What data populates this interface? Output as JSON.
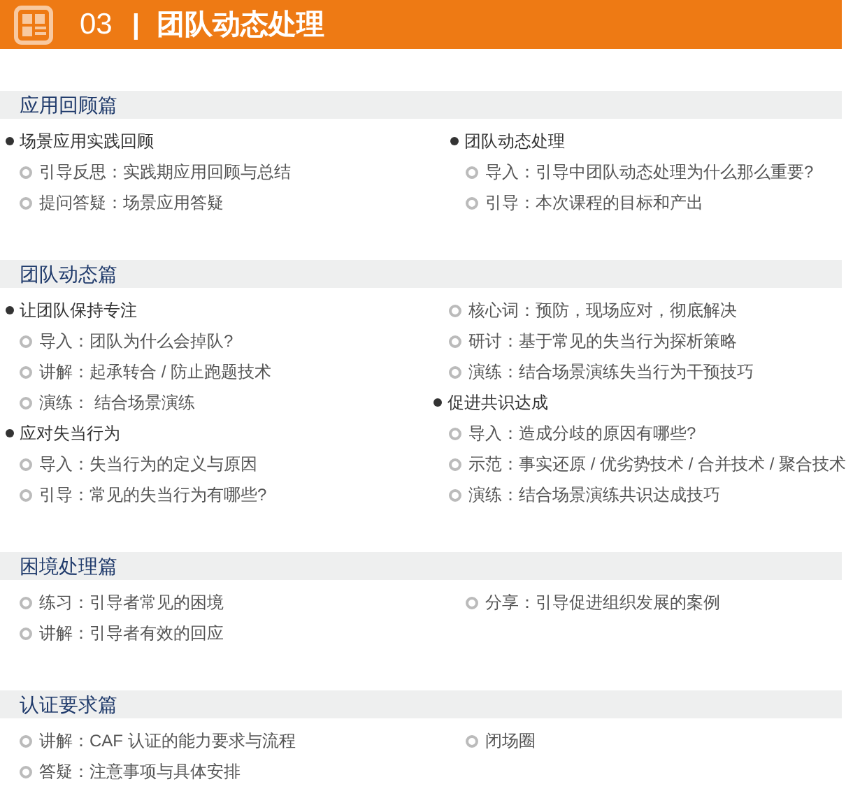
{
  "header": {
    "number": "03",
    "separator": "|",
    "title": "团队动态处理"
  },
  "sections": [
    {
      "title": "应用回顾篇",
      "columns": [
        [
          {
            "kind": "topic",
            "text": "场景应用实践回顾"
          },
          {
            "kind": "point",
            "text": "引导反思：实践期应用回顾与总结"
          },
          {
            "kind": "point",
            "text": "提问答疑：场景应用答疑"
          }
        ],
        [
          {
            "kind": "topic",
            "text": "团队动态处理"
          },
          {
            "kind": "point",
            "text": "导入：引导中团队动态处理为什么那么重要?"
          },
          {
            "kind": "point",
            "text": "引导：本次课程的目标和产出"
          }
        ]
      ]
    },
    {
      "title": "团队动态篇",
      "columns": [
        [
          {
            "kind": "topic",
            "text": "让团队保持专注"
          },
          {
            "kind": "point",
            "text": "导入：团队为什么会掉队?"
          },
          {
            "kind": "point",
            "text": "讲解：起承转合 / 防止跑题技术"
          },
          {
            "kind": "point",
            "text": "演练： 结合场景演练"
          },
          {
            "kind": "topic",
            "text": "应对失当行为"
          },
          {
            "kind": "point",
            "text": "导入：失当行为的定义与原因"
          },
          {
            "kind": "point",
            "text": "引导：常见的失当行为有哪些?"
          }
        ],
        [
          {
            "kind": "point",
            "text": "核心词：预防，现场应对，彻底解决"
          },
          {
            "kind": "point",
            "text": "研讨：基于常见的失当行为探析策略"
          },
          {
            "kind": "point",
            "text": "演练：结合场景演练失当行为干预技巧"
          },
          {
            "kind": "topic",
            "text": "促进共识达成"
          },
          {
            "kind": "point",
            "text": "导入：造成分歧的原因有哪些?"
          },
          {
            "kind": "point",
            "text": "示范：事实还原 / 优劣势技术 / 合并技术 / 聚合技术"
          },
          {
            "kind": "point",
            "text": "演练：结合场景演练共识达成技巧"
          }
        ]
      ]
    },
    {
      "title": "困境处理篇",
      "columns": [
        [
          {
            "kind": "point",
            "text": "练习：引导者常见的困境"
          },
          {
            "kind": "point",
            "text": "讲解：引导者有效的回应"
          }
        ],
        [
          {
            "kind": "point",
            "text": "分享：引导促进组织发展的案例"
          }
        ]
      ]
    },
    {
      "title": "认证要求篇",
      "columns": [
        [
          {
            "kind": "point",
            "text": "讲解：CAF 认证的能力要求与流程"
          },
          {
            "kind": "point",
            "text": "答疑：注意事项与具体安排"
          }
        ],
        [
          {
            "kind": "point",
            "text": "闭场圈"
          }
        ]
      ]
    }
  ]
}
